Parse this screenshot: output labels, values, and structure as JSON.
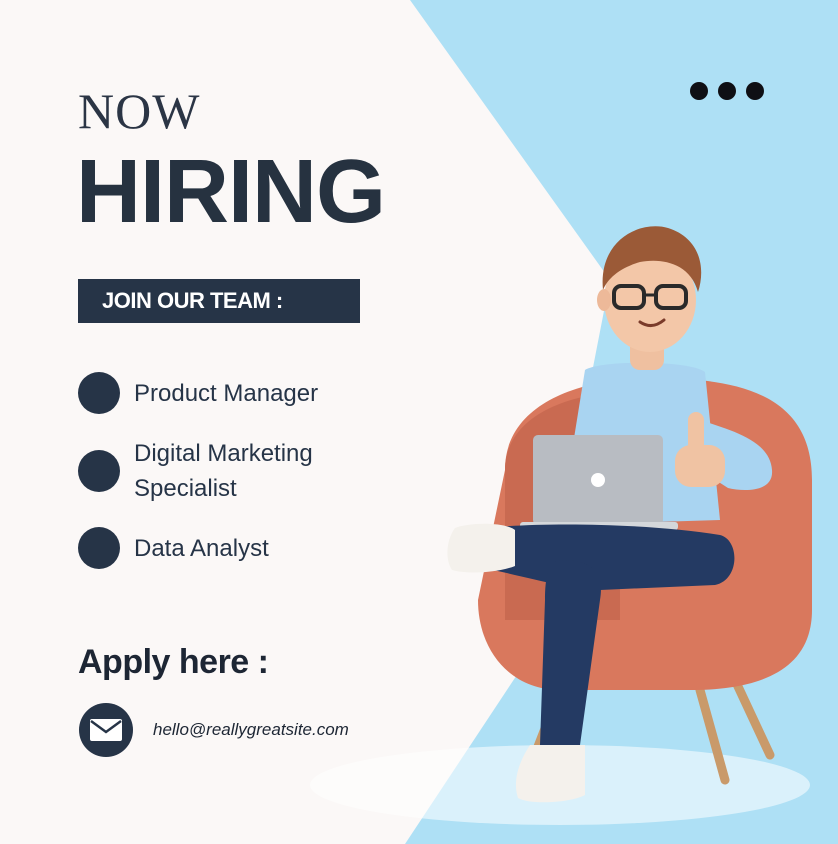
{
  "poster": {
    "headline_small": "NOW",
    "headline_large": "HIRING",
    "join_label": "JOIN OUR TEAM :",
    "jobs": [
      {
        "label": "Product Manager"
      },
      {
        "label": "Digital Marketing Specialist"
      },
      {
        "label": "Data Analyst"
      }
    ],
    "apply_label": "Apply here :",
    "email": "hello@reallygreatsite.com"
  },
  "icons": {
    "more": "more-dots-icon",
    "mail": "envelope-icon",
    "bullet": "bullet-circle-icon",
    "illustration": "man-with-laptop-in-armchair"
  },
  "colors": {
    "background": "#fbf8f7",
    "accent_blue": "#aee0f5",
    "navy": "#263447",
    "chair": "#d9785d"
  }
}
